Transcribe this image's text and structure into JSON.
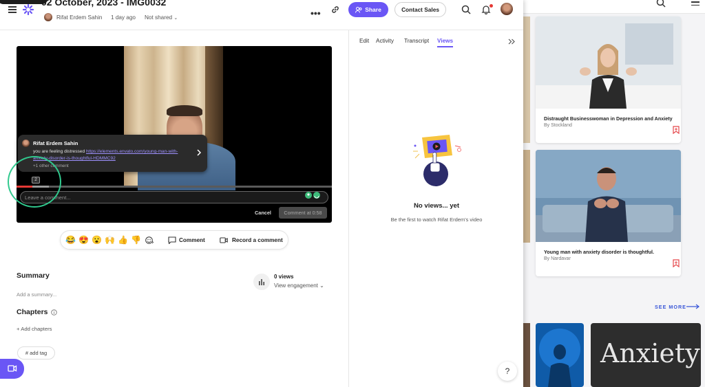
{
  "header": {
    "title": "02 October, 2023 - IMG0032",
    "owner": "Rifat Erdem Sahin",
    "time": "1 day ago",
    "share_status": "Not shared",
    "more_label": "•••",
    "share_label": "Share",
    "contact_label": "Contact Sales"
  },
  "player": {
    "comment_placeholder": "Leave a comment...",
    "cancel_label": "Cancel",
    "comment_at_label": "Comment at 0:58",
    "marker_count": "2",
    "tooltip": {
      "name": "Rifat Erdem Sahin",
      "text": "you are feeling distressed",
      "link": "https://elements.envato.com/young-man-with-anxiety-disorder-is-thoughtful-HDMMC92",
      "more": "+1 other comment"
    }
  },
  "reactions": {
    "emojis": [
      "😂",
      "😍",
      "😮",
      "🙌",
      "👍",
      "👎"
    ],
    "comment_label": "Comment",
    "record_label": "Record a comment"
  },
  "details": {
    "summary_heading": "Summary",
    "summary_placeholder": "Add a summary...",
    "chapters_heading": "Chapters",
    "add_chapters": "+ Add chapters",
    "tag_label": "# add tag",
    "views_count": "0 views",
    "view_engagement": "View engagement"
  },
  "panel": {
    "tabs": [
      "Edit",
      "Activity",
      "Transcript",
      "Views"
    ],
    "active_tab": "Views",
    "empty_title": "No views... yet",
    "empty_sub": "Be the first to watch Rifat Erdem's video",
    "help_label": "?"
  },
  "stock": {
    "cards": [
      {
        "title": "Distraught Businesswoman in Depression and Anxiety",
        "author": "By Stockland"
      },
      {
        "title": "Young man with anxiety disorder is thoughtful.",
        "author": "By Nardavar"
      }
    ],
    "see_more": "SEE MORE",
    "anxiety_text": "Anxiety"
  },
  "colors": {
    "accent": "#6a56f5",
    "highlight": "#31c98e",
    "progress": "#e53935",
    "stock_link": "#3a57d8"
  }
}
